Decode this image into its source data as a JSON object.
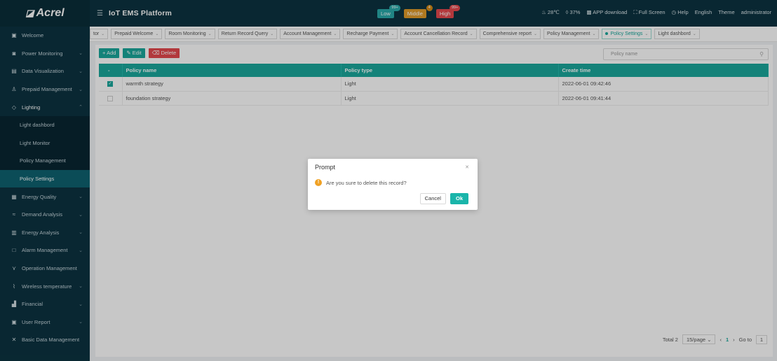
{
  "app": {
    "logo": "Acrel",
    "title": "IoT EMS Platform"
  },
  "alarms": {
    "low": {
      "label": "Low",
      "count": "99+"
    },
    "middle": {
      "label": "Middle",
      "count": "4"
    },
    "high": {
      "label": "High",
      "count": "99+"
    }
  },
  "header": {
    "temperature": "28℃",
    "humidity": "37%",
    "app_download": "APP download",
    "full_screen": "Full Screen",
    "help": "Help",
    "language": "English",
    "theme": "Theme",
    "user": "administrator"
  },
  "sidebar": {
    "items": [
      {
        "label": "Welcome",
        "icon": "monitor-icon"
      },
      {
        "label": "Power Monitoring",
        "icon": "power-icon"
      },
      {
        "label": "Data Visualization",
        "icon": "chart-icon"
      },
      {
        "label": "Prepaid Management",
        "icon": "user-icon"
      },
      {
        "label": "Lighting",
        "icon": "lightbulb-icon"
      },
      {
        "label": "Light dashbord"
      },
      {
        "label": "Light Monitor"
      },
      {
        "label": "Policy Management"
      },
      {
        "label": "Policy Settings"
      },
      {
        "label": "Energy Quality",
        "icon": "quality-icon"
      },
      {
        "label": "Demand Analysis",
        "icon": "demand-icon"
      },
      {
        "label": "Energy Analysis",
        "icon": "bar-icon"
      },
      {
        "label": "Alarm Management",
        "icon": "alarm-icon"
      },
      {
        "label": "Operation Management",
        "icon": "operation-icon"
      },
      {
        "label": "Wireless temperature",
        "icon": "thermometer-icon"
      },
      {
        "label": "Financial",
        "icon": "finance-icon"
      },
      {
        "label": "User Report",
        "icon": "report-icon"
      },
      {
        "label": "Basic Data Management",
        "icon": "data-icon"
      }
    ]
  },
  "tabs": [
    {
      "label": "tor"
    },
    {
      "label": "Prepaid Welcome"
    },
    {
      "label": "Room Monitoring"
    },
    {
      "label": "Return Record Query"
    },
    {
      "label": "Account Management"
    },
    {
      "label": "Recharge Payment"
    },
    {
      "label": "Account Cancellation Record"
    },
    {
      "label": "Comprehensive report"
    },
    {
      "label": "Policy Management"
    },
    {
      "label": "Policy Settings"
    },
    {
      "label": "Light dashbord"
    }
  ],
  "toolbar": {
    "add": "Add",
    "edit": "Edit",
    "delete": "Delete"
  },
  "search": {
    "placeholder": "Policy name"
  },
  "table": {
    "headers": [
      "Policy name",
      "Policy type",
      "Create time"
    ],
    "rows": [
      {
        "name": "warmth strategy",
        "type": "Light",
        "time": "2022-06-01 09:42:46",
        "checked": true
      },
      {
        "name": "foundation strategy",
        "type": "Light",
        "time": "2022-06-01 09:41:44",
        "checked": false
      }
    ]
  },
  "pagination": {
    "total": "Total 2",
    "page_size": "15/page",
    "current": "1",
    "goto_label": "Go to",
    "goto_value": "1"
  },
  "dialog": {
    "title": "Prompt",
    "message": "Are you sure to delete this record?",
    "cancel": "Cancel",
    "ok": "Ok"
  },
  "colors": {
    "primary": "#1aa79b",
    "danger": "#e5484d",
    "sidebar": "#0c3340",
    "warning": "#f0a124"
  }
}
